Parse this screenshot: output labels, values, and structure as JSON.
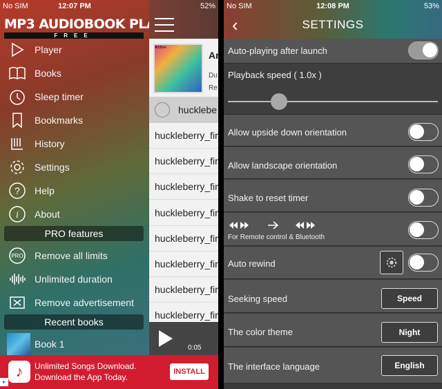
{
  "left": {
    "status": {
      "carrier": "No SIM",
      "time": "12:07 PM",
      "battery": "52%"
    },
    "logo": {
      "title": "MP3 AUDIOBOOK PLAYER",
      "subtitle": "FREE"
    },
    "menu": [
      {
        "label": "Player",
        "icon": "play-icon"
      },
      {
        "label": "Books",
        "icon": "book-icon"
      },
      {
        "label": "Sleep timer",
        "icon": "timer-icon"
      },
      {
        "label": "Bookmarks",
        "icon": "bookmark-icon"
      },
      {
        "label": "History",
        "icon": "history-icon"
      },
      {
        "label": "Settings",
        "icon": "gear-icon"
      },
      {
        "label": "Help",
        "icon": "help-icon"
      },
      {
        "label": "About",
        "icon": "info-icon"
      }
    ],
    "pro_section": "PRO features",
    "pro_items": [
      {
        "label": "Remove all limits",
        "icon": "pro-icon"
      },
      {
        "label": "Unlimited duration",
        "icon": "waveform-icon"
      },
      {
        "label": "Remove advertisement",
        "icon": "no-ads-icon"
      }
    ],
    "recent_section": "Recent books",
    "recent": [
      {
        "label": "Book 1"
      }
    ],
    "list": {
      "book_title": "Ar",
      "meta1": "Du",
      "meta2": "Re",
      "cover_tag": "Archive",
      "current": "hucklebe",
      "tracks": [
        "huckleberry_fin",
        "huckleberry_fin",
        "huckleberry_fin",
        "huckleberry_fin",
        "huckleberry_fin",
        "huckleberry_fin",
        "huckleberry_fin",
        "huckleberry_fin"
      ],
      "elapsed": "0:05"
    },
    "ad": {
      "line1": "Unlimited Songs Download.",
      "line2": "Download the App Today.",
      "button": "INSTALL"
    }
  },
  "right": {
    "status": {
      "carrier": "No SIM",
      "time": "12:08 PM",
      "battery": "53%"
    },
    "title": "SETTINGS",
    "back": "‹",
    "autoplay": {
      "label": "Auto-playing after launch",
      "on": true
    },
    "speed": {
      "label": "Playback speed ( 1.0x )",
      "value": 1.0
    },
    "upside_down": {
      "label": "Allow upside down orientation",
      "on": false
    },
    "landscape": {
      "label": "Allow landscape orientation",
      "on": false
    },
    "shake": {
      "label": "Shake to reset timer",
      "on": false
    },
    "remote": {
      "sublabel": "For Remote control & Bluetooth",
      "on": false
    },
    "auto_rewind": {
      "label": "Auto rewind",
      "on": false
    },
    "seeking": {
      "label": "Seeking speed",
      "button": "Speed"
    },
    "theme": {
      "label": "The color theme",
      "button": "Night"
    },
    "language": {
      "label": "The interface language",
      "button": "English"
    }
  }
}
